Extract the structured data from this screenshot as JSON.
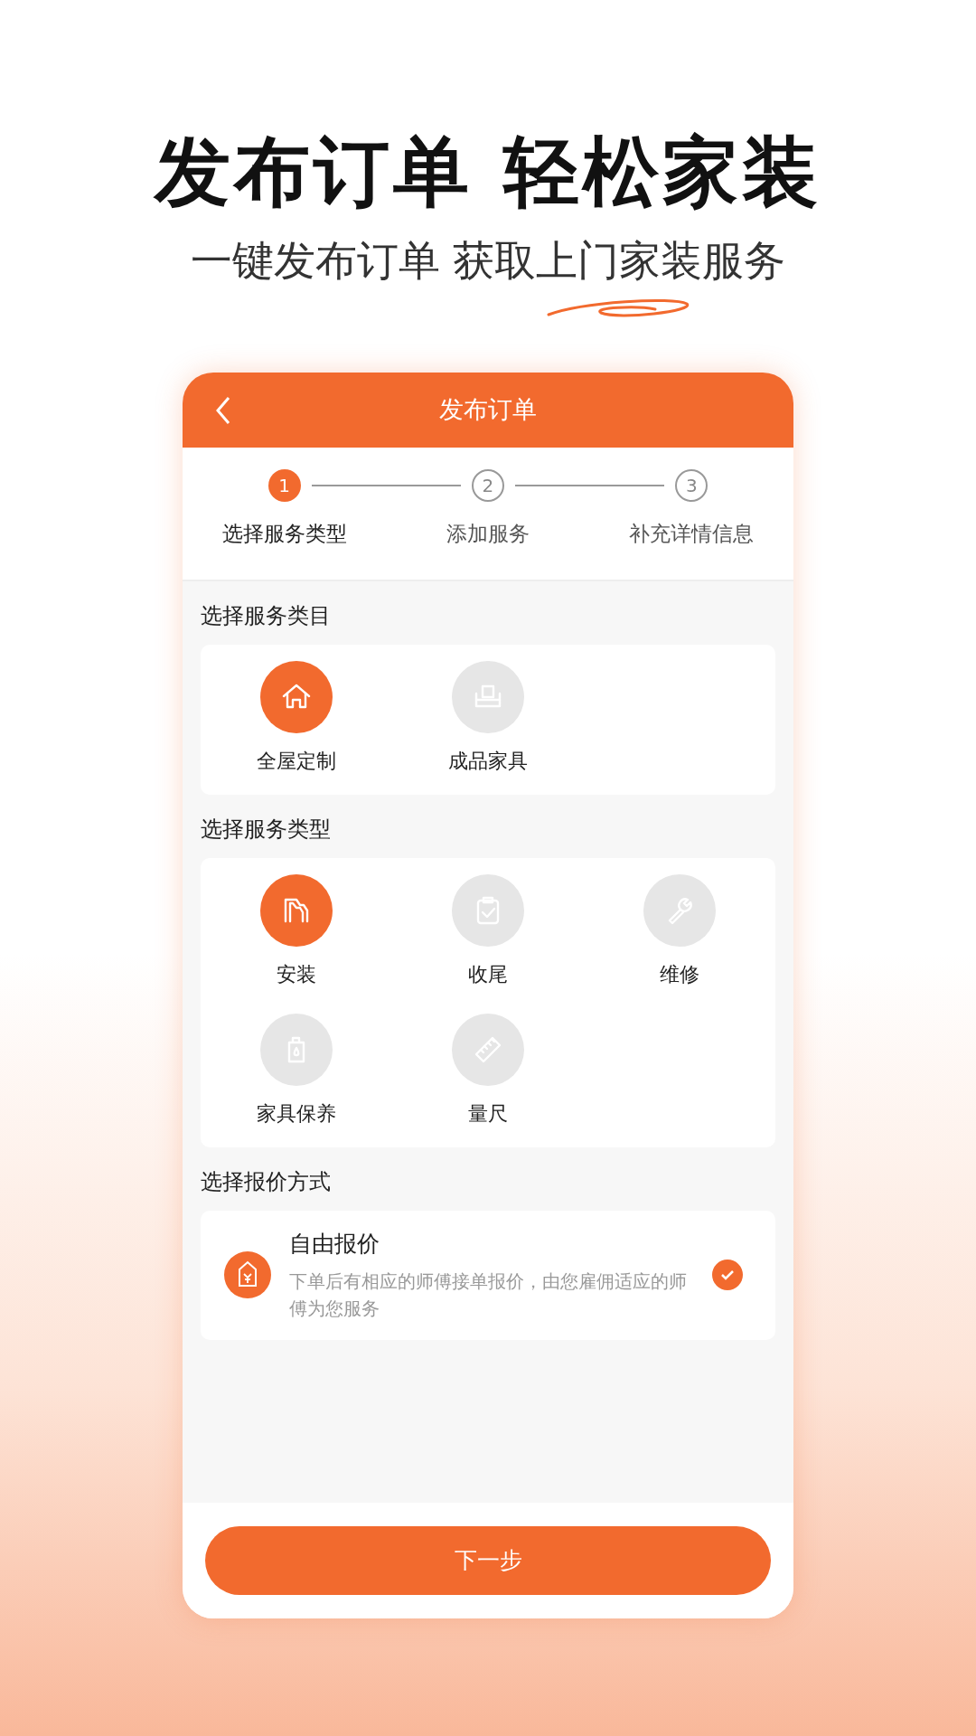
{
  "headline": "发布订单 轻松家装",
  "subheadline": "一键发布订单 获取上门家装服务",
  "app": {
    "title": "发布订单",
    "steps": [
      {
        "number": "1",
        "label": "选择服务类型",
        "selected": true
      },
      {
        "number": "2",
        "label": "添加服务",
        "selected": false
      },
      {
        "number": "3",
        "label": "补充详情信息",
        "selected": false
      }
    ],
    "sections": [
      {
        "title": "选择服务类目",
        "items": [
          {
            "kind": "house",
            "label": "全屋定制",
            "selected": true
          },
          {
            "kind": "sofa",
            "label": "成品家具",
            "selected": false
          }
        ]
      },
      {
        "title": "选择服务类型",
        "items": [
          {
            "kind": "install",
            "label": "安装",
            "selected": true
          },
          {
            "kind": "clipboard",
            "label": "收尾",
            "selected": false
          },
          {
            "kind": "wrench",
            "label": "维修",
            "selected": false
          },
          {
            "kind": "bottle",
            "label": "家具保养",
            "selected": false
          },
          {
            "kind": "ruler",
            "label": "量尺",
            "selected": false
          }
        ]
      }
    ],
    "pricing": {
      "title": "选择报价方式",
      "options": [
        {
          "name": "自由报价",
          "description": "下单后有相应的师傅接单报价，由您雇佣适应的师傅为您服务",
          "checked": true
        }
      ]
    },
    "next_button": "下一步"
  }
}
